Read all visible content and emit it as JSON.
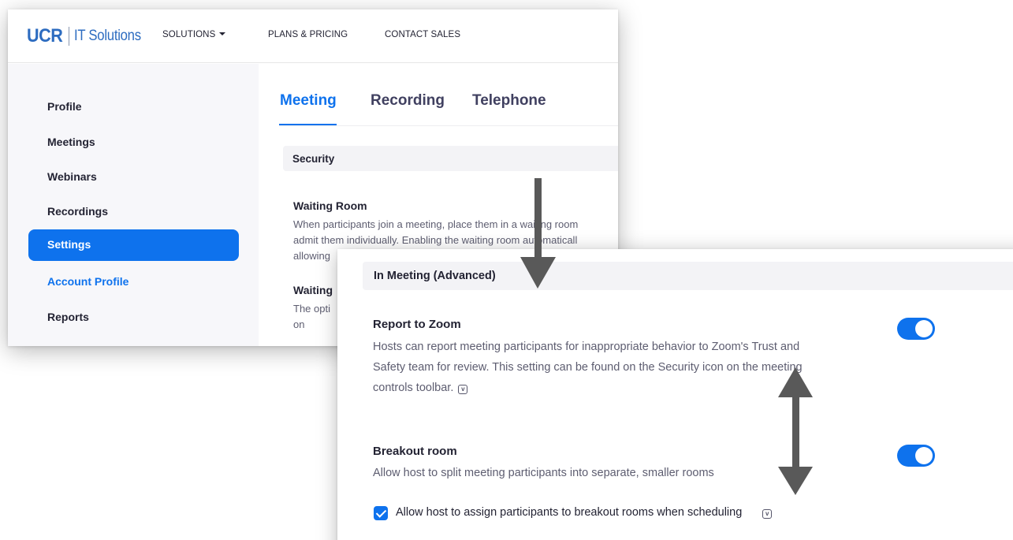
{
  "header": {
    "logo_ucr": "UCR",
    "logo_it": "IT Solutions",
    "nav": [
      {
        "label": "SOLUTIONS",
        "has_caret": true
      },
      {
        "label": "PLANS & PRICING",
        "has_caret": false
      },
      {
        "label": "CONTACT SALES",
        "has_caret": false
      }
    ]
  },
  "sidebar": {
    "items": [
      {
        "label": "Profile"
      },
      {
        "label": "Meetings"
      },
      {
        "label": "Webinars"
      },
      {
        "label": "Recordings"
      },
      {
        "label": "Settings",
        "active": true
      },
      {
        "label": "Account Profile",
        "link": true
      },
      {
        "label": "Reports"
      }
    ]
  },
  "tabs": [
    {
      "label": "Meeting",
      "active": true
    },
    {
      "label": "Recording"
    },
    {
      "label": "Telephone"
    }
  ],
  "security": {
    "section_label": "Security",
    "waiting_room_title": "Waiting Room",
    "waiting_room_desc": [
      "When participants join a meeting, place them in a waiting room",
      "admit them individually. Enabling the waiting room automaticall",
      "allowing"
    ],
    "next_title": "Waiting",
    "next_desc": [
      "The opti",
      "on"
    ]
  },
  "advanced": {
    "section_label": "In Meeting (Advanced)",
    "report": {
      "title": "Report to Zoom",
      "desc_lines": [
        "Hosts can report meeting participants for inappropriate behavior to Zoom's Trust and",
        "Safety team for review. This setting can be found on the Security icon on the meeting",
        "controls toolbar."
      ],
      "enabled": true
    },
    "breakout": {
      "title": "Breakout room",
      "desc": "Allow host to split meeting participants into separate, smaller rooms",
      "enabled": true,
      "checkbox_label": "Allow host to assign participants to breakout rooms when scheduling",
      "checkbox_checked": true
    }
  },
  "icons": {
    "info": "info-icon",
    "caret": "chevron-down-icon",
    "arrow": "arrow-annotation"
  },
  "colors": {
    "accent": "#0e72ed",
    "logo": "#2d6cc0",
    "arrow": "#595959"
  }
}
